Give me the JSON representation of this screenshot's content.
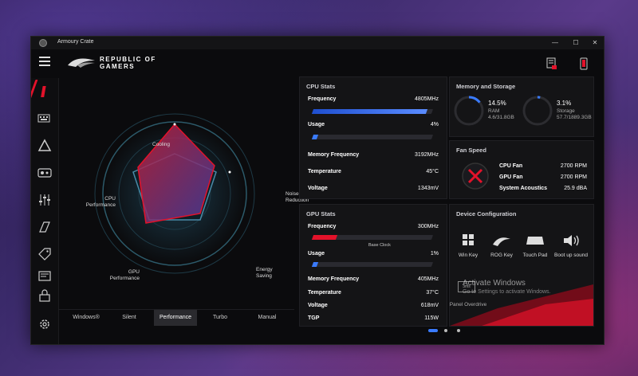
{
  "window": {
    "title": "Armoury Crate",
    "controls": {
      "minimize": "—",
      "maximize": "☐",
      "close": "✕"
    }
  },
  "brand": {
    "line1": "REPUBLIC OF",
    "line2": "GAMERS"
  },
  "radar": {
    "labels": {
      "cooling": "Cooling",
      "noise": [
        "Noise",
        "Reduction"
      ],
      "energy": [
        "Energy",
        "Saving"
      ],
      "gpu": [
        "GPU",
        "Performance"
      ],
      "cpu": [
        "CPU",
        "Performance"
      ]
    }
  },
  "modes": {
    "items": [
      "Windows®",
      "Silent",
      "Performance",
      "Turbo",
      "Manual"
    ],
    "selected": "Performance"
  },
  "cpu_stats": {
    "title": "CPU Stats",
    "frequency": {
      "label": "Frequency",
      "value": "4805MHz",
      "fraction": 0.95
    },
    "usage": {
      "label": "Usage",
      "value": "4%",
      "fraction": 0.04
    },
    "memory_frequency": {
      "label": "Memory Frequency",
      "value": "3192MHz"
    },
    "temperature": {
      "label": "Temperature",
      "value": "45°C"
    },
    "voltage": {
      "label": "Voltage",
      "value": "1343mV"
    }
  },
  "gpu_stats": {
    "title": "GPU Stats",
    "frequency": {
      "label": "Frequency",
      "value": "300MHz",
      "fraction": 0.2
    },
    "base_clock": "Base Clock",
    "usage": {
      "label": "Usage",
      "value": "1%",
      "fraction": 0.01
    },
    "memory_frequency": {
      "label": "Memory Frequency",
      "value": "405MHz"
    },
    "temperature": {
      "label": "Temperature",
      "value": "37°C"
    },
    "voltage": {
      "label": "Voltage",
      "value": "618mV"
    },
    "tgp": {
      "label": "TGP",
      "value": "115W"
    }
  },
  "memory_storage": {
    "title": "Memory and Storage",
    "ram": {
      "percent_text": "14.5%",
      "label": "RAM",
      "detail": "4.6/31.8GB",
      "fraction": 0.145
    },
    "storage": {
      "percent_text": "3.1%",
      "label": "Storage",
      "detail": "57.7/1889.3GB",
      "fraction": 0.031
    }
  },
  "fan_speed": {
    "title": "Fan Speed",
    "rows": [
      {
        "label": "CPU Fan",
        "value": "2700 RPM"
      },
      {
        "label": "GPU Fan",
        "value": "2700 RPM"
      },
      {
        "label": "System Acoustics",
        "value": "25.9 dBA"
      }
    ]
  },
  "device_config": {
    "title": "Device Configuration",
    "items": [
      {
        "label": "Win Key",
        "icon": "windows-key-icon"
      },
      {
        "label": "ROG Key",
        "icon": "rog-key-icon"
      },
      {
        "label": "Touch Pad",
        "icon": "touchpad-icon"
      },
      {
        "label": "Boot up sound",
        "icon": "bootup-sound-icon"
      },
      {
        "label": "Panel Overdrive",
        "icon": "panel-overdrive-icon"
      }
    ],
    "panel_overdrive_badge": "3ms"
  },
  "activation": {
    "title": "Activate Windows",
    "subtitle": "Go to Settings to activate Windows."
  },
  "colors": {
    "accent_red": "#e3122a",
    "accent_blue": "#3a7bff",
    "panel_bg": "#141416"
  }
}
